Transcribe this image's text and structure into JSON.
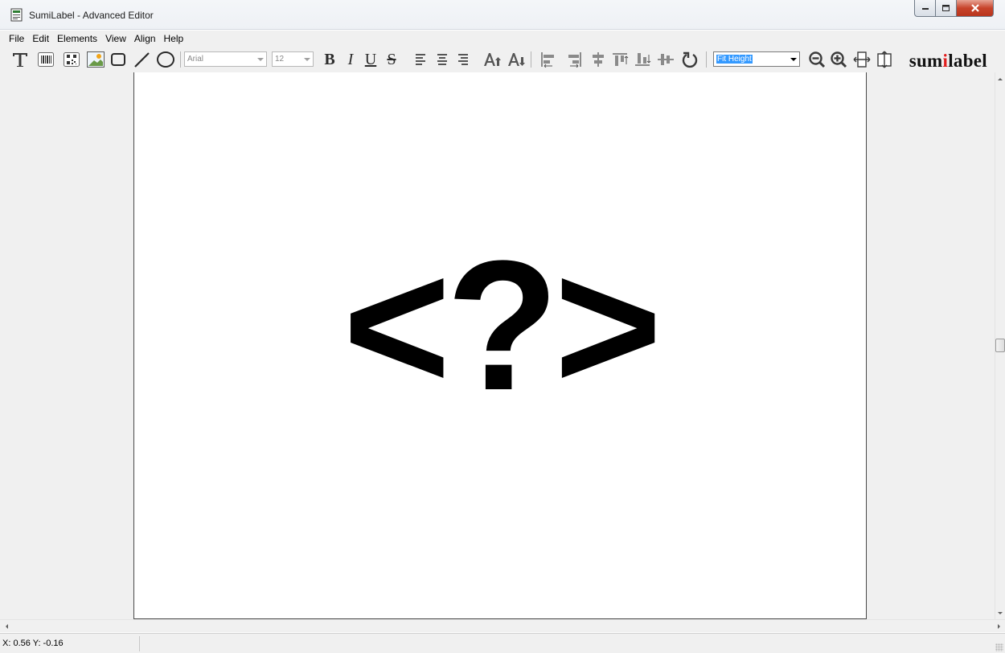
{
  "window": {
    "title": "SumiLabel - Advanced Editor",
    "app_icon": "label-editor-icon",
    "controls": [
      "minimize-icon",
      "maximize-icon",
      "close-icon"
    ]
  },
  "menu": {
    "items": [
      "File",
      "Edit",
      "Elements",
      "View",
      "Align",
      "Help"
    ]
  },
  "toolbar": {
    "element_tools": [
      "text-tool-icon",
      "barcode-tool-icon",
      "qrcode-tool-icon",
      "image-tool-icon",
      "rectangle-tool-icon",
      "line-tool-icon",
      "ellipse-tool-icon"
    ],
    "font_family": "Arial",
    "font_size": "12",
    "format_labels": {
      "bold": "B",
      "italic": "I",
      "underline": "U",
      "strikethrough": "S"
    },
    "text_tools": [
      "align-text-left-icon",
      "align-text-center-icon",
      "align-text-right-icon",
      "increase-font-size-icon",
      "decrease-font-size-icon"
    ],
    "align_tools": [
      "align-left-icon",
      "align-right-icon",
      "align-center-horizontal-icon",
      "align-top-icon",
      "align-bottom-icon",
      "align-middle-icon",
      "rotate-icon"
    ],
    "zoom_value": "Fit Height",
    "zoom_tools": [
      "zoom-out-icon",
      "zoom-in-icon",
      "fit-width-icon",
      "fit-height-icon"
    ],
    "brand": {
      "prefix": "sum",
      "accent": "i",
      "suffix": "label",
      "accent_color": "#e01e1e"
    }
  },
  "canvas": {
    "placeholder_text": "<?>"
  },
  "status": {
    "coordinates": "X: 0.56 Y: -0.16"
  }
}
